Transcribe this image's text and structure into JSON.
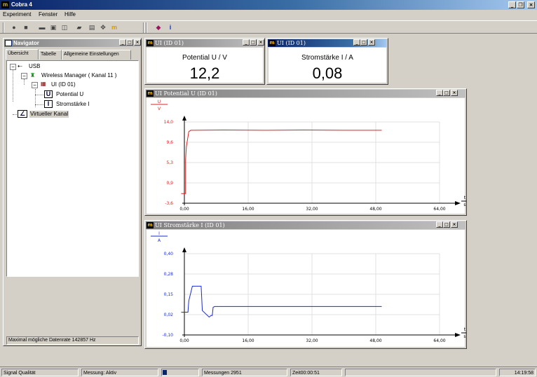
{
  "app": {
    "title": "Cobra 4"
  },
  "menu": [
    "Experiment",
    "Fenster",
    "Hilfe"
  ],
  "navigator": {
    "title": "Navigator",
    "tabs": [
      "Übersicht",
      "Tabelle",
      "Allgemeine Einstellungen"
    ],
    "tree": {
      "usb": "USB",
      "wireless": "Wireless Manager ( Kanal 11 )",
      "ui": "UI (ID 01)",
      "potential": "Potential U",
      "strom": "Stromstärke I",
      "virtual": "Virtueller Kanal"
    },
    "status": "Maximal mögliche Datenrate 142857 Hz"
  },
  "display1": {
    "title": "UI (ID 01)",
    "label": "Potential U / V",
    "value": "12,2"
  },
  "display2": {
    "title": "UI (ID 01)",
    "label": "Stromstärke I / A",
    "value": "0,08"
  },
  "graph1": {
    "title": "UI  Potential U (ID 01)",
    "ylabel_top": "U",
    "ylabel_bottom": "V",
    "xlabel_top": "t",
    "xlabel_bottom": "s",
    "color": "#e02020"
  },
  "graph2": {
    "title": "UI  Stromstärke I (ID 01)",
    "ylabel_top": "I",
    "ylabel_bottom": "A",
    "xlabel_top": "t",
    "xlabel_bottom": "s",
    "color": "#1a2ad0"
  },
  "chart_data": [
    {
      "type": "line",
      "name": "graph1",
      "xlabel": "t / s",
      "ylabel": "U / V",
      "xlim": [
        0,
        64
      ],
      "ylim": [
        -3.6,
        14.0
      ],
      "xticks": [
        "0,00",
        "16,00",
        "32,00",
        "48,00",
        "64,00"
      ],
      "yticks": [
        "-3,6",
        "0,9",
        "5,3",
        "9,6",
        "14,0"
      ],
      "series": [
        {
          "x": [
            -0.8,
            0.3,
            0.3,
            0.5,
            1.1,
            1.6,
            10,
            20,
            30,
            40,
            49.5
          ],
          "y": [
            -1.5,
            -1.5,
            5.8,
            8.6,
            11.9,
            12.2,
            12.25,
            12.2,
            12.25,
            12.2,
            12.2
          ]
        }
      ],
      "grid": true
    },
    {
      "type": "line",
      "name": "graph2",
      "xlabel": "t / s",
      "ylabel": "I / A",
      "xlim": [
        0,
        64
      ],
      "ylim": [
        -0.1,
        0.4
      ],
      "xticks": [
        "0,00",
        "16,00",
        "32,00",
        "48,00",
        "64,00"
      ],
      "yticks": [
        "-0,10",
        "0,02",
        "0,15",
        "0,28",
        "0,40"
      ],
      "series": [
        {
          "x": [
            -0.8,
            0.9,
            1.1,
            2.0,
            4.2,
            4.5,
            6.2,
            6.7,
            7.0,
            7.2,
            7.6,
            8.4,
            12,
            20,
            30,
            40,
            49.5
          ],
          "y": [
            0.04,
            0.04,
            0.11,
            0.2,
            0.2,
            0.05,
            0.01,
            0.02,
            0.02,
            0.07,
            0.075,
            0.075,
            0.075,
            0.075,
            0.075,
            0.075,
            0.075
          ]
        }
      ],
      "grid": true
    }
  ],
  "statusbar": {
    "signal": "Signal Qualität",
    "messung": "Messung: Aktiv",
    "messungen": "Messungen 2951",
    "zeit": "Zeit00:00:51",
    "clock": "14:19:58"
  }
}
